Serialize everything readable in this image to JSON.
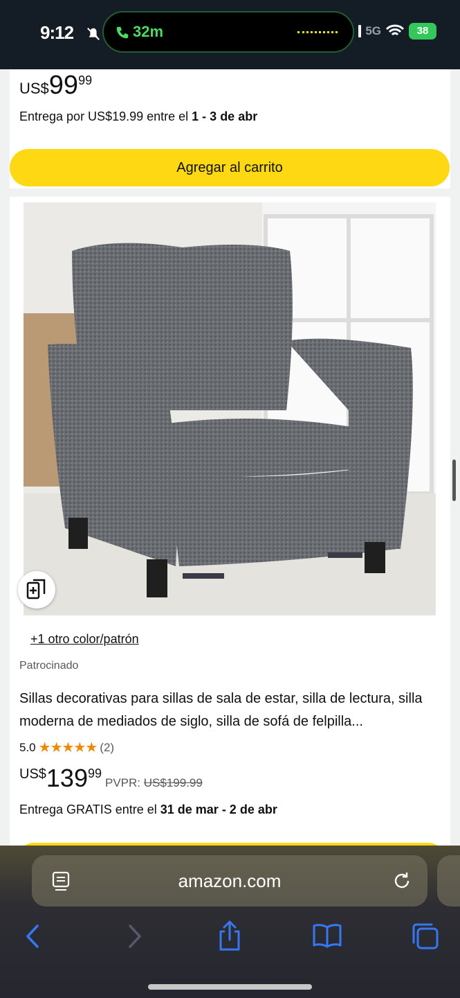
{
  "status": {
    "time": "9:12",
    "call_duration": "32m",
    "network": "5G",
    "battery": "38"
  },
  "top_card": {
    "currency": "US$",
    "price_whole": "99",
    "price_fraction": "99",
    "delivery_prefix": "Entrega por US$19.99 entre el ",
    "delivery_dates": "1 - 3 de abr",
    "add_to_cart": "Agregar al carrito"
  },
  "product": {
    "color_link": "+1 otro color/patrón",
    "sponsored": "Patrocinado",
    "title": "Sillas decorativas para sillas de sala de estar, silla de lectura, silla moderna de mediados de siglo, silla de sofá de felpilla...",
    "rating": "5.0",
    "stars": "★★★★★",
    "review_count": "(2)",
    "currency": "US$",
    "price_whole": "139",
    "price_fraction": "99",
    "list_price_label": "PVPR: ",
    "list_price": "US$199.99",
    "delivery_prefix": "Entrega GRATIS entre el ",
    "delivery_dates": "31 de mar - 2 de abr"
  },
  "browser": {
    "url": "amazon.com"
  },
  "icons": {
    "back": "chevron-left-icon",
    "forward": "chevron-right-icon",
    "share": "share-icon",
    "bookmarks": "book-icon",
    "tabs": "tabs-icon"
  },
  "colors": {
    "accent_button": "#ffd814",
    "star": "#f08804",
    "safari_blue": "#3478f6"
  }
}
